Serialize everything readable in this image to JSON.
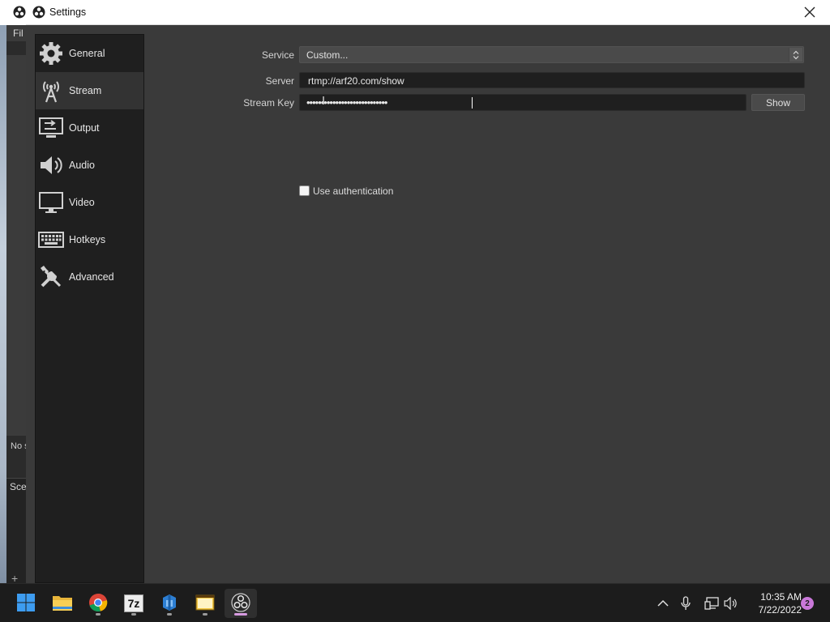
{
  "background_window": {
    "menu_file": "Fil",
    "no_source_text": "No s",
    "scenes_label": "Sce"
  },
  "dialog": {
    "title": "Settings",
    "close_icon": "close-icon"
  },
  "sidebar": {
    "items": [
      {
        "label": "General",
        "icon": "gear-icon",
        "active": false
      },
      {
        "label": "Stream",
        "icon": "broadcast-tower-icon",
        "active": true
      },
      {
        "label": "Output",
        "icon": "output-monitor-icon",
        "active": false
      },
      {
        "label": "Audio",
        "icon": "speaker-icon",
        "active": false
      },
      {
        "label": "Video",
        "icon": "monitor-icon",
        "active": false
      },
      {
        "label": "Hotkeys",
        "icon": "keyboard-icon",
        "active": false
      },
      {
        "label": "Advanced",
        "icon": "tools-icon",
        "active": false
      }
    ]
  },
  "stream_form": {
    "service_label": "Service",
    "service_value": "Custom...",
    "server_label": "Server",
    "server_value": "rtmp://arf20.com/show",
    "stream_key_label": "Stream Key",
    "stream_key_masked": "••••••••••••••••••••••••••••",
    "show_button": "Show",
    "use_auth_label": "Use authentication",
    "use_auth_checked": false
  },
  "taskbar": {
    "apps": [
      {
        "name": "start-button",
        "icon": "windows-logo-icon"
      },
      {
        "name": "file-explorer",
        "icon": "folder-icon"
      },
      {
        "name": "chrome",
        "icon": "chrome-icon"
      },
      {
        "name": "7zip",
        "icon": "7zip-icon",
        "text": "7z"
      },
      {
        "name": "app-4",
        "icon": "blue-app-icon"
      },
      {
        "name": "app-5",
        "icon": "yellow-window-icon"
      },
      {
        "name": "obs",
        "icon": "obs-icon",
        "active": true
      }
    ],
    "tray": [
      "chevron-up-icon",
      "microphone-icon",
      "network-icon",
      "volume-icon"
    ],
    "time": "10:35 AM",
    "date": "7/22/2022",
    "notification_count": "2"
  },
  "colors": {
    "dialog_bg": "#3a3a3a",
    "sidebar_bg": "#1f1f1f",
    "input_bg": "#1f1f1f",
    "taskbar_bg": "#1c1c1c",
    "notification_badge": "#c978d9"
  }
}
